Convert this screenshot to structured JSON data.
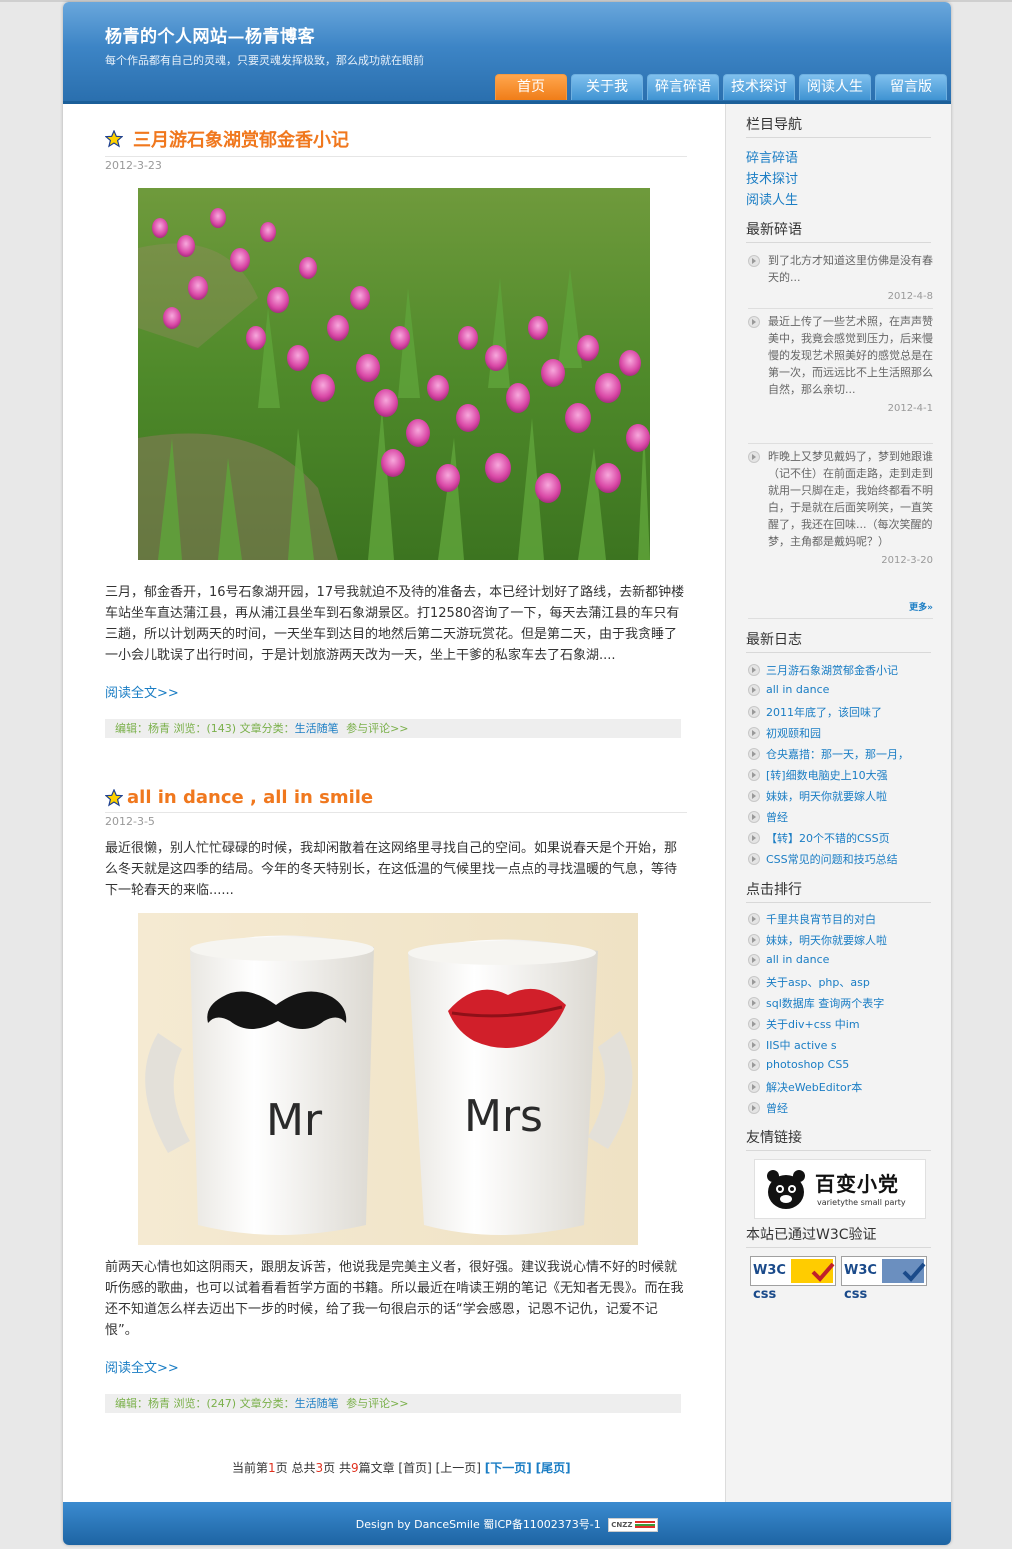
{
  "site": {
    "title": "杨青的个人网站—杨青博客",
    "subtitle": "每个作品都有自己的灵魂，只要灵魂发挥极致，那么成功就在眼前"
  },
  "nav": [
    "首页",
    "关于我",
    "碎言碎语",
    "技术探讨",
    "阅读人生",
    "留言版"
  ],
  "posts": [
    {
      "title": "三月游石象湖赏郁金香小记",
      "date": "2012-3-23",
      "image": "tulip-field-photo",
      "text": "三月，郁金香开，16号石象湖开园，17号我就迫不及待的准备去，本已经计划好了路线，去新都钟楼车站坐车直达蒲江县，再从浦江县坐车到石象湖景区。打12580咨询了一下，每天去蒲江县的车只有三趟，所以计划两天的时间，一天坐车到达目的地然后第二天游玩赏花。但是第二天，由于我贪睡了一小会儿耽误了出行时间，于是计划旅游两天改为一天，坐上干爹的私家车去了石象湖....",
      "readmore": "阅读全文>>",
      "meta_prefix": "编辑：杨青  浏览：(143)  文章分类：",
      "category": "生活随笔",
      "comment": "参与评论>>"
    },
    {
      "title": "all in dance , all in smile",
      "date": "2012-3-5",
      "intro": "最近很懒，别人忙忙碌碌的时候，我却闲散着在这网络里寻找自己的空间。如果说春天是个开始，那么冬天就是这四季的结局。今年的冬天特别长，在这低温的气候里找一点点的寻找温暖的气息，等待下一轮春天的来临......",
      "image": "mr-mrs-mugs-photo",
      "mug_left": "Mr",
      "mug_right": "Mrs",
      "text": "前两天心情也如这阴雨天，跟朋友诉苦，他说我是完美主义者，很好强。建议我说心情不好的时候就听伤感的歌曲，也可以试着看看哲学方面的书籍。所以最近在啃读王朔的笔记《无知者无畏》。而在我还不知道怎么样去迈出下一步的时候，给了我一句很启示的话“学会感恩，记恩不记仇，记爱不记恨”。",
      "readmore": "阅读全文>>",
      "meta_prefix": "编辑：杨青  浏览：(247)  文章分类：",
      "category": "生活随笔",
      "comment": "参与评论>>"
    }
  ],
  "pager": {
    "p1": "当前第",
    "cur": "1",
    "p2": "页  总共",
    "total": "3",
    "p3": "页  共",
    "count": "9",
    "p4": "篇文章  [首页] [上一页] ",
    "next": "[下一页]",
    "last": "[尾页]"
  },
  "sidebar": {
    "nav_title": "栏目导航",
    "nav_links": [
      "碎言碎语",
      "技术探讨",
      "阅读人生"
    ],
    "notes_title": "最新碎语",
    "notes": [
      {
        "text": "到了北方才知道这里仿佛是没有春天的...",
        "date": "2012-4-8"
      },
      {
        "text": "最近上传了一些艺术照，在声声赞美中，我竟会感觉到压力，后来慢慢的发现艺术照美好的感觉总是在第一次，而远远比不上生活照那么自然，那么亲切...",
        "date": "2012-4-1"
      },
      {
        "text": "昨晚上又梦见戴妈了，梦到她跟谁（记不住）在前面走路，走到走到就用一只脚在走，我始终都看不明白，于是就在后面笑咧笑，一直笑醒了，我还在回味...（每次笑醒的梦，主角都是戴妈呢？）",
        "date": "2012-3-20"
      }
    ],
    "more": "更多»",
    "latest_title": "最新日志",
    "latest": [
      "三月游石象湖赏郁金香小记",
      "all in dance",
      "2011年底了，该回味了",
      "初观颐和园",
      "仓央嘉措：那一天，那一月，",
      "[转]细数电脑史上10大强",
      "妹妹，明天你就要嫁人啦",
      "曾经",
      "【转】20个不错的CSS页",
      "CSS常见的问题和技巧总结"
    ],
    "rank_title": "点击排行",
    "rank": [
      "千里共良宵节目的对白",
      "妹妹，明天你就要嫁人啦",
      "all in dance",
      "关于asp、php、asp",
      "sql数据库 查询两个表字",
      "关于div+css 中im",
      "IIS中  active s",
      "photoshop CS5",
      "解决eWebEditor本",
      "曾经"
    ],
    "friends_title": "友情链接",
    "friend_logo_cn": "百变小党",
    "friend_logo_en": "varietythe small party",
    "w3c_title": "本站已通过W3C验证",
    "w3c_badges": [
      "W3C css",
      "W3C css"
    ]
  },
  "footer": {
    "text": "Design by DanceSmile  蜀ICP备11002373号-1",
    "cnzz": "CNZZ"
  },
  "colors": {
    "accent_orange": "#f0781e",
    "link_blue": "#1a7dc4",
    "header_blue": "#3d85c6"
  }
}
